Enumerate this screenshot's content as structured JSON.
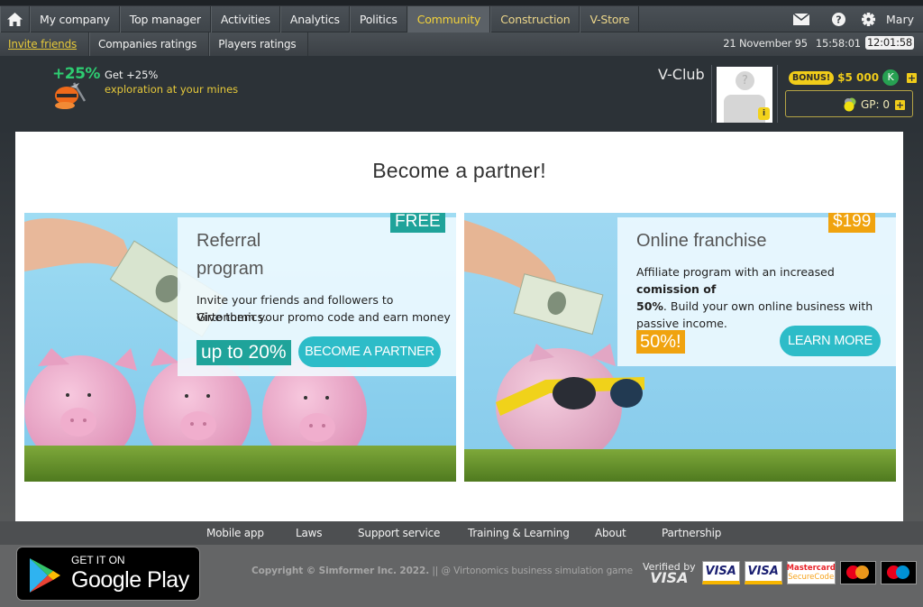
{
  "nav": {
    "home_icon": "home-icon",
    "items": [
      {
        "label": "My company",
        "active": false
      },
      {
        "label": "Top manager",
        "active": false
      },
      {
        "label": "Activities",
        "active": false
      },
      {
        "label": "Analytics",
        "active": false
      },
      {
        "label": "Politics",
        "active": false
      },
      {
        "label": "Community",
        "active": true
      },
      {
        "label": "Construction",
        "active": false
      },
      {
        "label": "V-Store",
        "active": false
      }
    ],
    "right_icons": [
      "mail-icon",
      "help-icon",
      "gear-icon"
    ],
    "user_name": "Mary"
  },
  "subnav": {
    "items": [
      {
        "label": "Invite friends",
        "active": true
      },
      {
        "label": "Companies ratings",
        "active": false
      },
      {
        "label": "Players ratings",
        "active": false
      }
    ],
    "game_date": "21 November 95",
    "game_time": "15:58:01",
    "real_time": "12:01:58"
  },
  "promo": {
    "badge": "+25%",
    "line1": "Get +25%",
    "line2": "exploration at your mines"
  },
  "account": {
    "vclub_label": "V-Club",
    "avatar_placeholder": "?",
    "avatar_info": "i",
    "bonus_badge": "BONUS!",
    "bonus_amount": "$5 000",
    "currency_icon": "K",
    "gp_label": "GP: 0",
    "plus": "+"
  },
  "main": {
    "title": "Become a partner!",
    "cards": [
      {
        "price_tag": "FREE",
        "title_line1": "Referral",
        "title_line2": "program",
        "desc_line1": "Invite your friends and followers to Virtonomics.",
        "desc_line2": "Give them your promo code and earn money",
        "highlight": "up to 20%",
        "cta": "BECOME A PARTNER"
      },
      {
        "price_tag": "$199",
        "title": "Online franchise",
        "desc_pre": "Affiliate program with an increased ",
        "desc_bold1": "comission of",
        "desc_bold2": "50%",
        "desc_post": ". Build your own online business with",
        "desc_line3": "passive income.",
        "highlight": "50%!",
        "cta": "LEARN MORE"
      }
    ]
  },
  "footer": {
    "links": [
      "Mobile app",
      "Laws",
      "Support service",
      "Training & Learning",
      "About",
      "Partnership"
    ],
    "google_play_top": "GET IT ON",
    "google_play_bottom": "Google Play",
    "copyright_bold": "Copyright © Simformer Inc. 2022.",
    "copyright_rest": " || @ Virtonomics business simulation game",
    "verified_by": "Verified by",
    "visa": "VISA",
    "mastercard": "Mastercard",
    "securecode": "SecureCode"
  },
  "colors": {
    "accent_yellow": "#f2d23b",
    "teal": "#1fa39a",
    "cta": "#2dbcc8",
    "orange": "#f0a30f",
    "green": "#2ecc71"
  }
}
